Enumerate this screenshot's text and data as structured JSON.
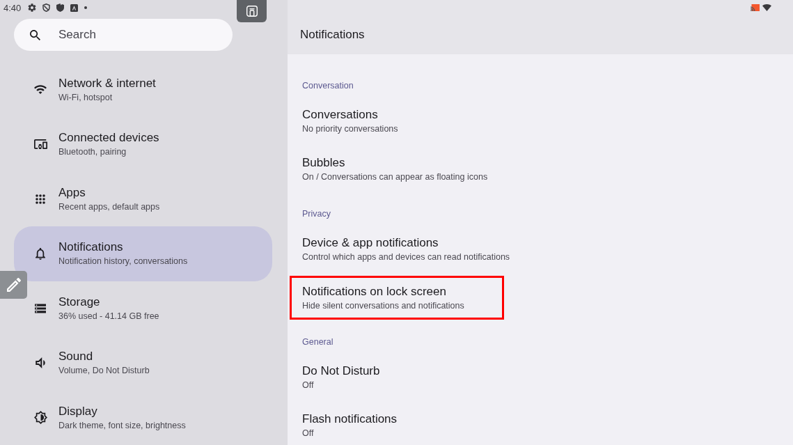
{
  "status_bar": {
    "time": "4:40"
  },
  "search": {
    "placeholder": "Search"
  },
  "sidebar": {
    "items": [
      {
        "title": "Network & internet",
        "subtitle": "Wi-Fi, hotspot",
        "selected": false
      },
      {
        "title": "Connected devices",
        "subtitle": "Bluetooth, pairing",
        "selected": false
      },
      {
        "title": "Apps",
        "subtitle": "Recent apps, default apps",
        "selected": false
      },
      {
        "title": "Notifications",
        "subtitle": "Notification history, conversations",
        "selected": true
      },
      {
        "title": "Storage",
        "subtitle": "36% used - 41.14 GB free",
        "selected": false
      },
      {
        "title": "Sound",
        "subtitle": "Volume, Do Not Disturb",
        "selected": false
      },
      {
        "title": "Display",
        "subtitle": "Dark theme, font size, brightness",
        "selected": false
      }
    ]
  },
  "page": {
    "title": "Notifications",
    "sections": [
      {
        "header": "Conversation",
        "items": [
          {
            "title": "Conversations",
            "subtitle": "No priority conversations",
            "highlighted": false
          },
          {
            "title": "Bubbles",
            "subtitle": "On / Conversations can appear as floating icons",
            "highlighted": false
          }
        ]
      },
      {
        "header": "Privacy",
        "items": [
          {
            "title": "Device & app notifications",
            "subtitle": "Control which apps and devices can read notifications",
            "highlighted": false
          },
          {
            "title": "Notifications on lock screen",
            "subtitle": "Hide silent conversations and notifications",
            "highlighted": true
          }
        ]
      },
      {
        "header": "General",
        "items": [
          {
            "title": "Do Not Disturb",
            "subtitle": "Off",
            "highlighted": false
          },
          {
            "title": "Flash notifications",
            "subtitle": "Off",
            "highlighted": false
          }
        ]
      }
    ]
  }
}
